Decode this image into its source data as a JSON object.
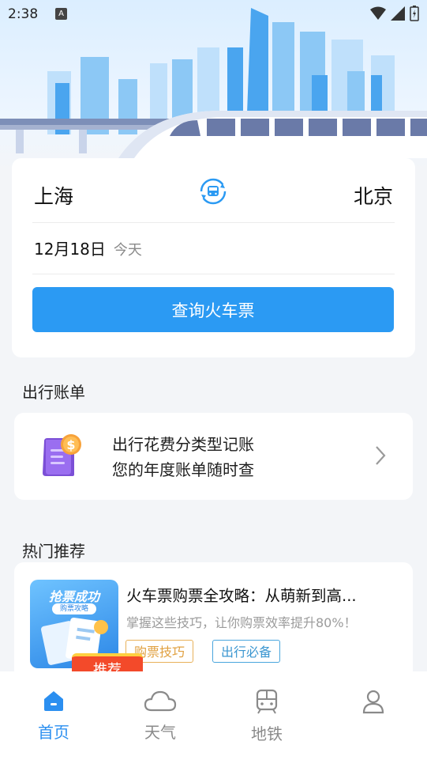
{
  "status_bar": {
    "time": "2:38",
    "notification_icon": "A"
  },
  "search": {
    "from_city": "上海",
    "to_city": "北京",
    "date": "12月18日",
    "date_note": "今天",
    "button_label": "查询火车票"
  },
  "bill": {
    "section_title": "出行账单",
    "line1": "出行花费分类型记账",
    "line2": "您的年度账单随时查"
  },
  "recommend": {
    "section_title": "热门推荐",
    "thumb_title": "抢票成功",
    "thumb_subtitle": "购票攻略",
    "title": "火车票购票全攻略：从萌新到高...",
    "description": "掌握这些技巧，让你购票效率提升80%！",
    "tags": [
      "购票技巧",
      "出行必备"
    ],
    "badge": "推荐"
  },
  "nav": {
    "items": [
      {
        "label": "首页",
        "icon": "home-icon",
        "active": true
      },
      {
        "label": "天气",
        "icon": "cloud-icon",
        "active": false
      },
      {
        "label": "地铁",
        "icon": "train-icon",
        "active": false
      },
      {
        "label": "",
        "icon": "user-icon",
        "active": false
      }
    ],
    "active_color": "#2b8ff0",
    "inactive_color": "#8a8a8a"
  },
  "colors": {
    "primary": "#2b9af3",
    "badge": "#f34a2a"
  }
}
